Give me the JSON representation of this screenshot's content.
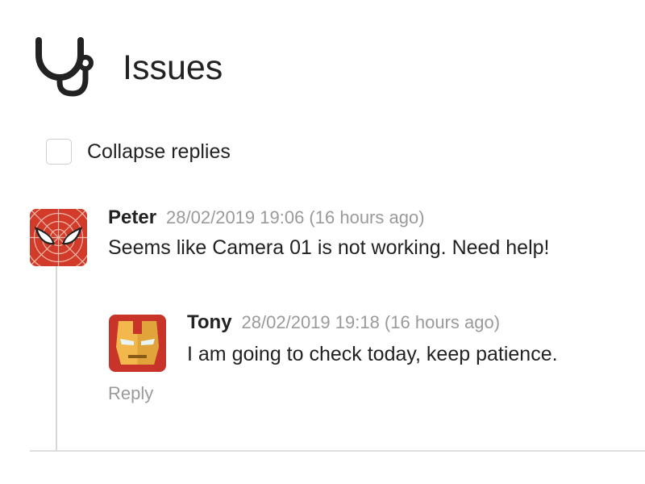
{
  "header": {
    "title": "Issues",
    "icon": "stethoscope-icon"
  },
  "collapse": {
    "label": "Collapse replies",
    "checked": false
  },
  "comments": [
    {
      "author": "Peter",
      "timestamp": "28/02/2019 19:06 (16 hours ago)",
      "text": "Seems like Camera 01 is not working. Need help!",
      "avatar": "spiderman-avatar",
      "replies": [
        {
          "author": "Tony",
          "timestamp": "28/02/2019 19:18 (16 hours ago)",
          "text": "I am going to check today, keep patience.",
          "avatar": "ironman-avatar"
        }
      ],
      "reply_label": "Reply"
    }
  ],
  "colors": {
    "text": "#222222",
    "muted": "#9a9a9a",
    "line": "#d6d6d6",
    "spider_red": "#d23a2a",
    "iron_gold": "#f2b84b",
    "iron_red": "#c9342a"
  }
}
